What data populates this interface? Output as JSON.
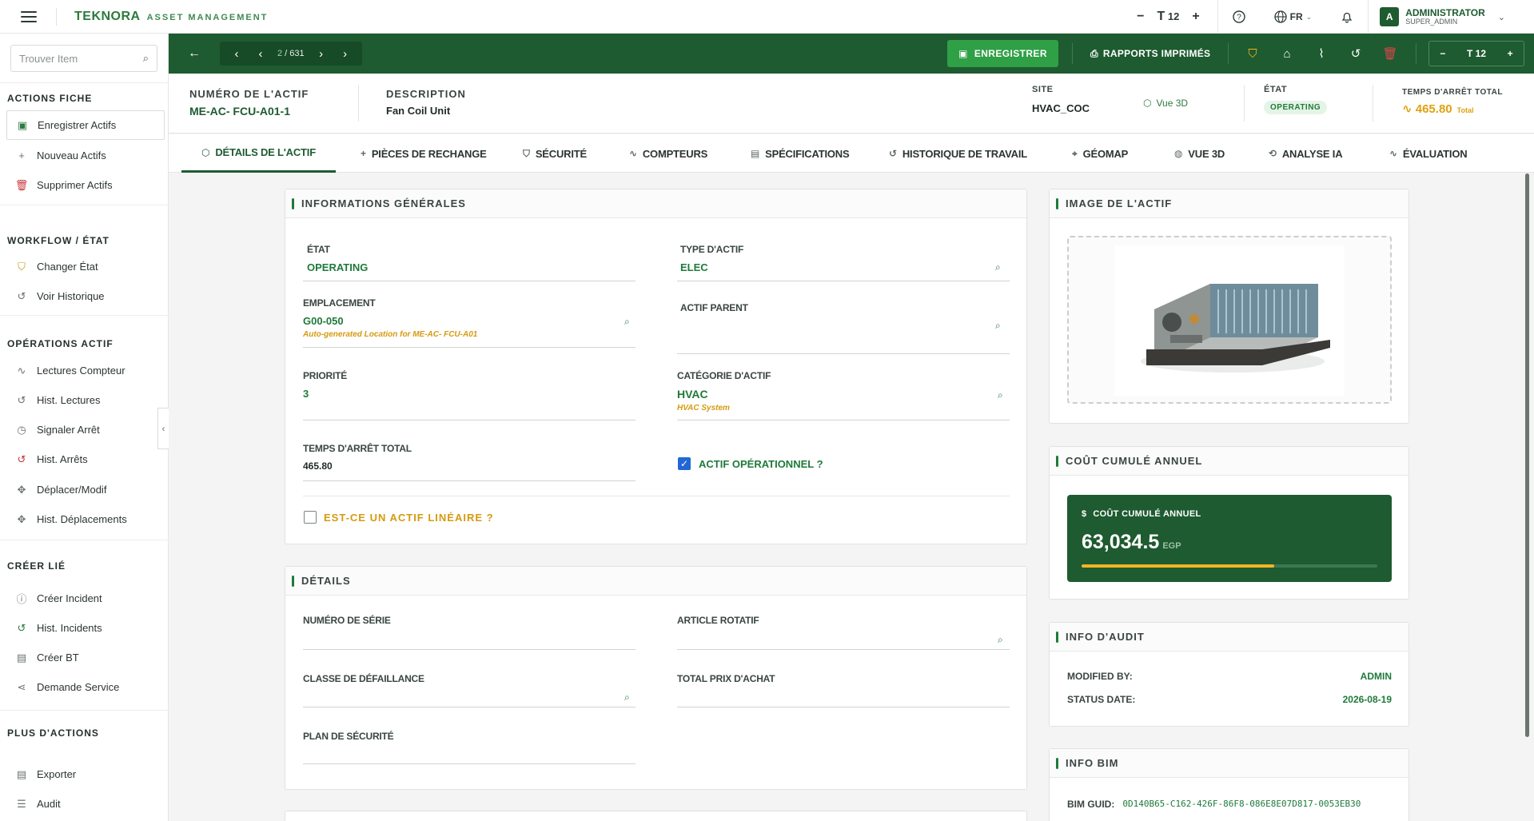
{
  "topbar": {
    "brand_logo": "TEKNORA",
    "brand_sub": "ASSET MANAGEMENT",
    "text_size": "12",
    "lang": "FR",
    "user_initial": "A",
    "user_name": "ADMINISTRATOR",
    "user_role": "SUPER_ADMIN"
  },
  "sidebar": {
    "search_placeholder": "Trouver Item",
    "sections": {
      "fiche": "ACTIONS FICHE",
      "workflow": "WORKFLOW / ÉTAT",
      "operations": "OPÉRATIONS ACTIF",
      "create": "CRÉER LIÉ",
      "more": "PLUS D'ACTIONS"
    },
    "items": {
      "save_assets": "Enregistrer Actifs",
      "new_assets": "Nouveau Actifs",
      "delete_assets": "Supprimer Actifs",
      "change_state": "Changer État",
      "view_history": "Voir Historique",
      "meter_readings": "Lectures Compteur",
      "hist_readings": "Hist. Lectures",
      "report_stop": "Signaler Arrêt",
      "hist_stops": "Hist. Arrêts",
      "move_modify": "Déplacer/Modif",
      "hist_moves": "Hist. Déplacements",
      "create_incident": "Créer Incident",
      "hist_incidents": "Hist. Incidents",
      "create_wo": "Créer BT",
      "service_request": "Demande Service",
      "export": "Exporter",
      "audit": "Audit"
    }
  },
  "toolbar": {
    "page_current": "2",
    "page_total": "631",
    "save_label": "ENREGISTRER",
    "reports_label": "RAPPORTS IMPRIMÉS",
    "text_size": "12"
  },
  "header": {
    "asset_number_label": "NUMÉRO DE L'ACTIF",
    "asset_number": "ME-AC- FCU-A01-1",
    "description_label": "DESCRIPTION",
    "description": "Fan Coil Unit",
    "site_label": "SITE",
    "site": "HVAC_COC",
    "view3d": "Vue 3D",
    "state_label": "ÉTAT",
    "state": "OPERATING",
    "downtime_label": "TEMPS D'ARRÊT TOTAL",
    "downtime": "465.80",
    "downtime_suffix": "Total"
  },
  "tabs": [
    {
      "label": "DÉTAILS DE L'ACTIF",
      "icon": "cube-icon",
      "active": true
    },
    {
      "label": "PIÈCES DE RECHANGE",
      "icon": "plus-icon"
    },
    {
      "label": "SÉCURITÉ",
      "icon": "shield-icon"
    },
    {
      "label": "COMPTEURS",
      "icon": "pulse-icon"
    },
    {
      "label": "SPÉCIFICATIONS",
      "icon": "document-icon"
    },
    {
      "label": "HISTORIQUE DE TRAVAIL",
      "icon": "history-icon"
    },
    {
      "label": "GÉOMAP",
      "icon": "pin-icon"
    },
    {
      "label": "VUE 3D",
      "icon": "globe-icon"
    },
    {
      "label": "ANALYSE IA",
      "icon": "brain-icon"
    },
    {
      "label": "ÉVALUATION",
      "icon": "pulse-icon"
    }
  ],
  "general": {
    "title": "INFORMATIONS GÉNÉRALES",
    "state_label": "ÉTAT",
    "state": "OPERATING",
    "asset_type_label": "TYPE D'ACTIF",
    "asset_type": "ELEC",
    "location_label": "EMPLACEMENT",
    "location": "G00-050",
    "location_desc": "Auto-generated Location for ME-AC- FCU-A01",
    "parent_label": "ACTIF PARENT",
    "parent": "",
    "priority_label": "PRIORITÉ",
    "priority": "3",
    "category_label": "CATÉGORIE D'ACTIF",
    "category": "HVAC",
    "category_desc": "HVAC System",
    "downtime_label": "TEMPS D'ARRÊT TOTAL",
    "downtime": "465.80",
    "operational_label": "ACTIF OPÉRATIONNEL ?",
    "operational": true,
    "linear_label": "EST-CE UN ACTIF LINÉAIRE ?",
    "linear": false
  },
  "details": {
    "title": "DÉTAILS",
    "serial_label": "NUMÉRO DE SÉRIE",
    "serial": "",
    "rotating_label": "ARTICLE ROTATIF",
    "rotating": "",
    "failure_class_label": "CLASSE DE DÉFAILLANCE",
    "failure_class": "",
    "purchase_total_label": "TOTAL PRIX D'ACHAT",
    "purchase_total": "",
    "safety_plan_label": "PLAN DE SÉCURITÉ",
    "safety_plan": ""
  },
  "image_card": {
    "title": "IMAGE DE L'ACTIF"
  },
  "cost_card": {
    "title": "COÛT CUMULÉ ANNUEL",
    "label": "COÛT CUMULÉ ANNUEL",
    "value": "63,034.5",
    "currency": "EGP",
    "progress": 0.65
  },
  "audit_card": {
    "title": "INFO D'AUDIT",
    "modified_by_label": "MODIFIED BY:",
    "modified_by": "ADMIN",
    "status_date_label": "STATUS DATE:",
    "status_date": "2026-08-19"
  },
  "bim_card": {
    "title": "INFO BIM",
    "guid_label": "BIM GUID:",
    "guid": "0D140B65-C162-426F-86F8-086E8E07D817-0053EB30"
  },
  "colors": {
    "primary": "#1e5b30",
    "accent": "#2fa046",
    "warning": "#e0a10e",
    "danger": "#c7363a"
  }
}
